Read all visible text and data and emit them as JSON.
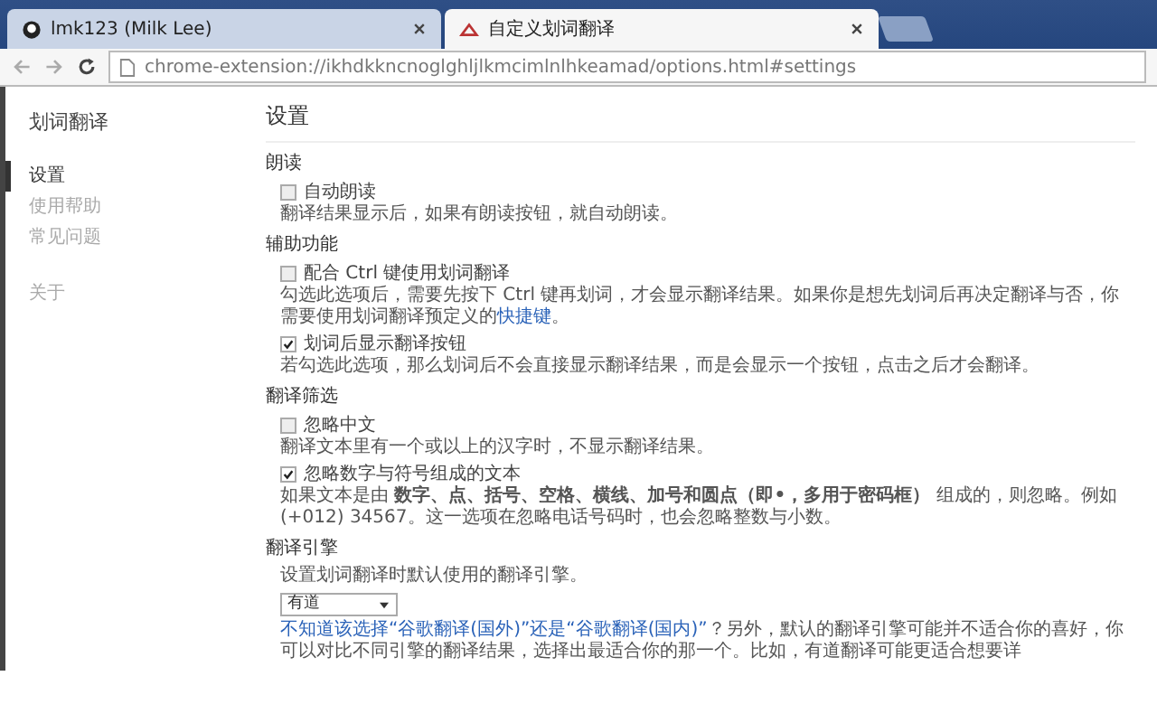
{
  "browser": {
    "tabs": [
      {
        "title": "lmk123 (Milk Lee)",
        "selected": false
      },
      {
        "title": "自定义划词翻译",
        "selected": true
      }
    ],
    "url": "chrome-extension://ikhdkkncnoglghljlkmcimlnlhkeamad/options.html#settings"
  },
  "sidebar": {
    "title": "划词翻译",
    "items": [
      {
        "label": "设置",
        "selected": true
      },
      {
        "label": "使用帮助",
        "selected": false
      },
      {
        "label": "常见问题",
        "selected": false
      },
      {
        "label": "关于",
        "selected": false
      }
    ]
  },
  "page_title": "设置",
  "sections": [
    {
      "heading": "朗读",
      "items": [
        {
          "kind": "checkbox",
          "label": "自动朗读",
          "checked": false,
          "description": "翻译结果显示后，如果有朗读按钮，就自动朗读。"
        }
      ]
    },
    {
      "heading": "辅助功能",
      "items": [
        {
          "kind": "checkbox",
          "label": "配合 Ctrl 键使用划词翻译",
          "checked": false,
          "description": "勾选此选项后，需要先按下 Ctrl 键再划词，才会显示翻译结果。如果你是想先划词后再决定翻译与否，你需要使用划词翻译预定义的",
          "link": "快捷键",
          "after": "。"
        },
        {
          "kind": "checkbox",
          "label": "划词后显示翻译按钮",
          "checked": true,
          "description": "若勾选此选项，那么划词后不会直接显示翻译结果，而是会显示一个按钮，点击之后才会翻译。"
        }
      ]
    },
    {
      "heading": "翻译筛选",
      "items": [
        {
          "kind": "checkbox",
          "label": "忽略中文",
          "checked": false,
          "description": "翻译文本里有一个或以上的汉字时，不显示翻译结果。"
        },
        {
          "kind": "checkbox",
          "label": "忽略数字与符号组成的文本",
          "checked": true,
          "description": "如果文本是由 **数字、点、括号、空格、横线、加号和圆点（即•，多用于密码框）** 组成的，则忽略。例如 (+012) 34567。这一选项在忽略电话号码时，也会忽略整数与小数。"
        }
      ]
    },
    {
      "heading": "翻译引擎",
      "items": [
        {
          "kind": "text",
          "description": "设置划词翻译时默认使用的翻译引擎。"
        },
        {
          "kind": "select",
          "value": "有道"
        },
        {
          "kind": "note",
          "link": "不知道该选择“谷歌翻译(国外)”还是“谷歌翻译(国内)”",
          "description": "？另外，默认的翻译引擎可能并不适合你的喜好，你可以对比不同引擎的翻译结果，选择出最适合你的那一个。比如，有道翻译可能更适合想要详"
        }
      ]
    }
  ]
}
